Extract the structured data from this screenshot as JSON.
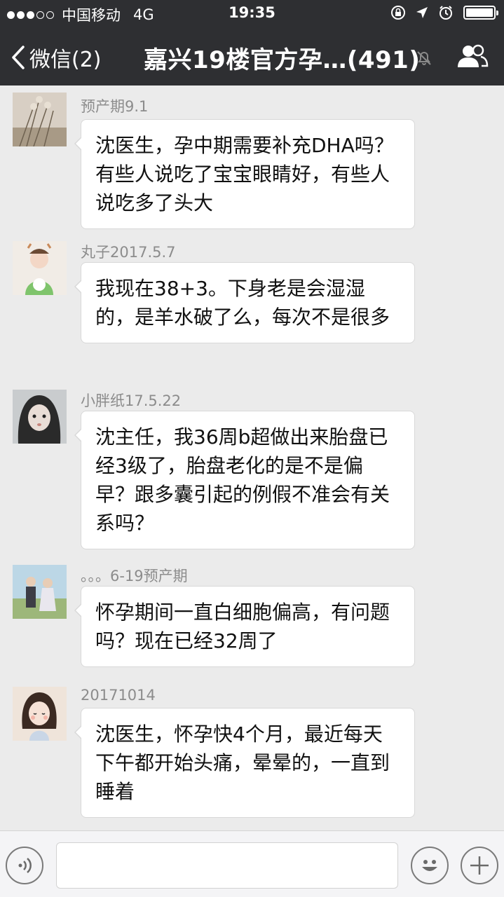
{
  "status_bar": {
    "carrier": "中国移动",
    "network": "4G",
    "time": "19:35"
  },
  "nav": {
    "back_label": "微信(2)",
    "title": "嘉兴19楼官方孕…(491)"
  },
  "messages": [
    {
      "sender": "预产期9.1",
      "text": "沈医生，孕中期需要补充DHA吗？有些人说吃了宝宝眼睛好，有些人说吃多了头大"
    },
    {
      "sender": "丸子2017.5.7",
      "text": "我现在38+3。下身老是会湿湿的，是羊水破了么，每次不是很多"
    },
    {
      "sender": "小胖纸17.5.22",
      "text": "沈主任，我36周b超做出来胎盘已经3级了，胎盘老化的是不是偏早？跟多囊引起的例假不准会有关系吗？"
    },
    {
      "sender": "。。。6-19预产期",
      "text": "怀孕期间一直白细胞偏高，有问题吗？现在已经32周了"
    },
    {
      "sender": "20171014",
      "text": "沈医生，怀孕快4个月，最近每天下午都开始头痛，晕晕的，一直到睡着"
    }
  ],
  "input": {
    "placeholder": ""
  }
}
